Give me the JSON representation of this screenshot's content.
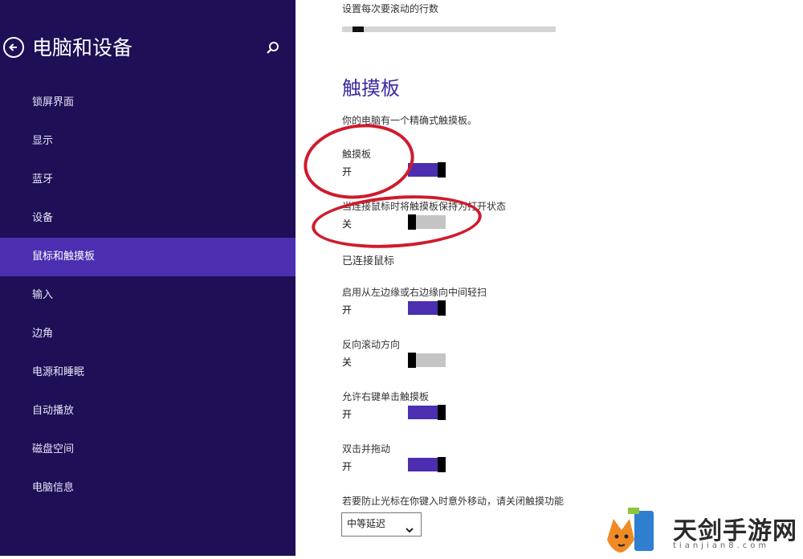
{
  "sidebar": {
    "title": "电脑和设备",
    "items": [
      {
        "label": "锁屏界面"
      },
      {
        "label": "显示"
      },
      {
        "label": "蓝牙"
      },
      {
        "label": "设备"
      },
      {
        "label": "鼠标和触摸板"
      },
      {
        "label": "输入"
      },
      {
        "label": "边角"
      },
      {
        "label": "电源和睡眠"
      },
      {
        "label": "自动播放"
      },
      {
        "label": "磁盘空间"
      },
      {
        "label": "电脑信息"
      }
    ],
    "active_item": "鼠标和触摸板"
  },
  "content": {
    "scroll_label": "设置每次要滚动的行数",
    "scroll_level": 0.05,
    "section_title": "触摸板",
    "description": "你的电脑有一个精确式触摸板。",
    "settings": [
      {
        "label": "触摸板",
        "state": "开",
        "on": true
      },
      {
        "label": "当连接鼠标时将触摸板保持为打开状态",
        "state": "关",
        "on": false
      },
      {
        "label": "已连接鼠标"
      },
      {
        "label": "启用从左边缘或右边缘向中间轻扫",
        "state": "开",
        "on": true
      },
      {
        "label": "反向滚动方向",
        "state": "关",
        "on": false
      },
      {
        "label": "允许右键单击触摸板",
        "state": "开",
        "on": true
      },
      {
        "label": "双击并拖动",
        "state": "开",
        "on": true
      }
    ],
    "delay_note": "若要防止光标在你键入时意外移动，请关闭触摸功能",
    "delay_value": "中等延迟"
  },
  "watermark": {
    "text": "天剑手游网",
    "url": "tianjian8.com"
  },
  "colors": {
    "sidebar_bg": "#1e0f57",
    "accent": "#4b2fb0",
    "annotation": "#cf1b2c"
  },
  "icons": {
    "back": "back-arrow-icon",
    "search": "search-icon",
    "dropdown": "chevron-down-icon"
  }
}
